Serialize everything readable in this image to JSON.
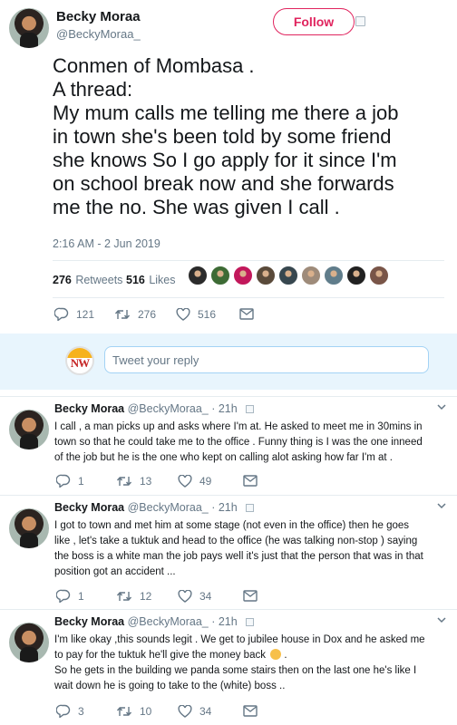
{
  "main_tweet": {
    "name": "Becky Moraa",
    "handle": "@BeckyMoraa_",
    "follow_label": "Follow",
    "text_lines": [
      "Conmen of Mombasa .",
      "A thread:",
      "My mum calls me telling me there a job",
      "in town she's been told by some friend",
      "she knows So I go apply for it since I'm",
      "on school break now and she forwards",
      "me the no. She was given I call ."
    ],
    "timestamp": "2:16 AM - 2 Jun 2019",
    "retweets_count": "276",
    "retweets_label": "Retweets",
    "likes_count": "516",
    "likes_label": "Likes",
    "liker_colors": [
      "#2b2b2b",
      "#3d6b35",
      "#c2185b",
      "#5a4a3a",
      "#37474f",
      "#9e8b7a",
      "#607d8b",
      "#212121",
      "#795548"
    ],
    "actions": {
      "replies": "121",
      "retweets": "276",
      "likes": "516"
    }
  },
  "reply_box": {
    "logo_text": "NW",
    "placeholder": "Tweet your reply"
  },
  "replies": [
    {
      "name": "Becky Moraa",
      "handle": "@BeckyMoraa_",
      "time": "· 21h",
      "lines": [
        "I call , a man picks up and asks where I'm at. He asked to meet me in 30mins in",
        "town so that he could take me to the office . Funny thing is I was the one inneed",
        "of the job but he is the one who kept on calling alot asking how far I'm at ."
      ],
      "replies": "1",
      "retweets": "13",
      "likes": "49"
    },
    {
      "name": "Becky Moraa",
      "handle": "@BeckyMoraa_",
      "time": "· 21h",
      "lines": [
        "I got to town and met him at some stage (not even in the office) then he goes",
        "like , let's take a tuktuk and head to the office (he was talking non-stop ) saying",
        "the boss is a white man the job pays well it's just that the person that was in that",
        "position got an accident ..."
      ],
      "replies": "1",
      "retweets": "12",
      "likes": "34"
    },
    {
      "name": "Becky Moraa",
      "handle": "@BeckyMoraa_",
      "time": "· 21h",
      "lines": [
        "I'm like okay ,this sounds legit . We get to jubilee house in Dox and he asked me",
        "to pay for the tuktuk he'll give the money back",
        "So he gets in the building we panda some stairs then on the last one he's like I",
        "wait down he is going to take to the (white) boss .."
      ],
      "line2_suffix": " .",
      "replies": "3",
      "retweets": "10",
      "likes": "34"
    }
  ]
}
